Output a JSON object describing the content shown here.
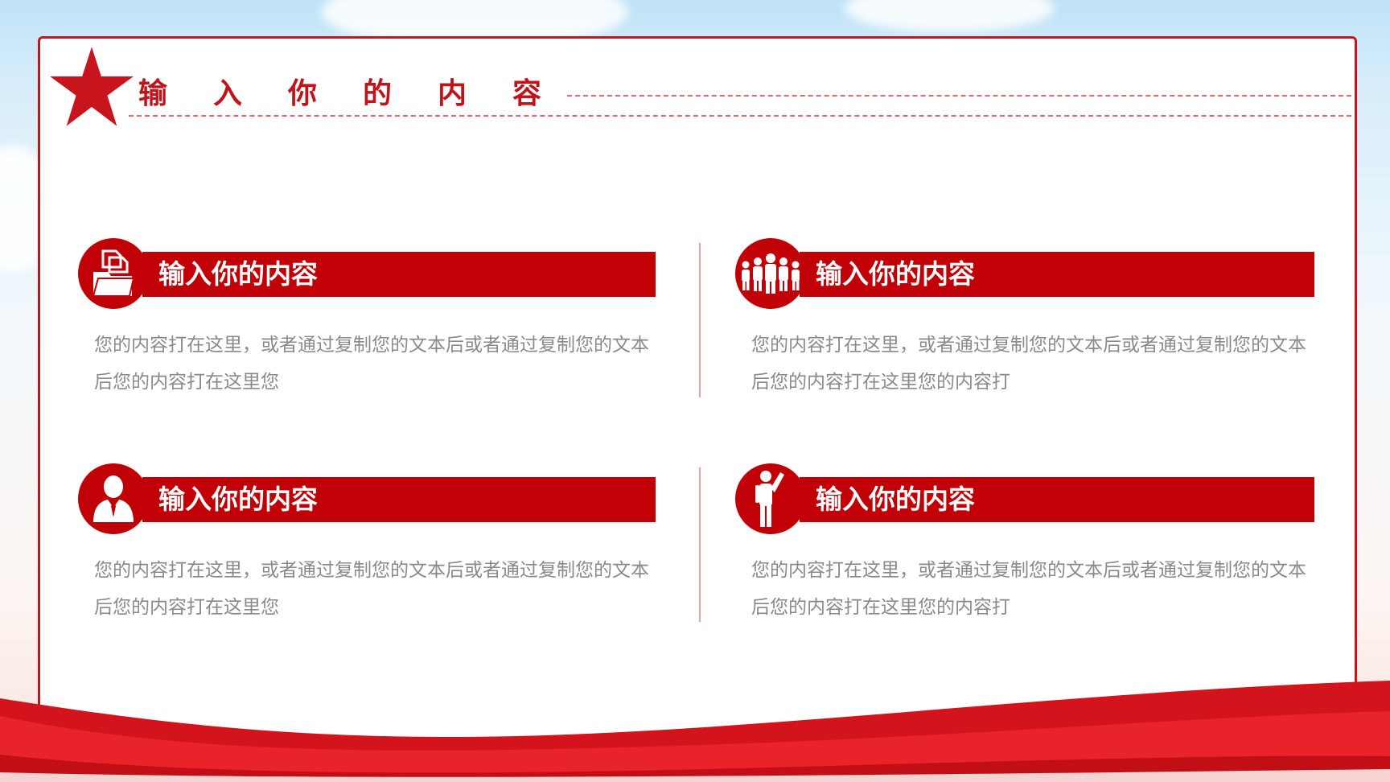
{
  "slide": {
    "title": "输入你的内容",
    "accent_color": "#c00006",
    "items": [
      {
        "heading": "输入你的内容",
        "icon": "folder-documents-icon",
        "body": "您的内容打在这里，或者通过复制您的文本后或者通过复制您的文本后您的内容打在这里您"
      },
      {
        "heading": "输入你的内容",
        "icon": "team-people-icon",
        "body": "您的内容打在这里，或者通过复制您的文本后或者通过复制您的文本后您的内容打在这里您的内容打"
      },
      {
        "heading": "输入你的内容",
        "icon": "business-person-icon",
        "body": "您的内容打在这里，或者通过复制您的文本后或者通过复制您的文本后您的内容打在这里您"
      },
      {
        "heading": "输入你的内容",
        "icon": "person-raising-hand-icon",
        "body": "您的内容打在这里，或者通过复制您的文本后或者通过复制您的文本后您的内容打在这里您的内容打"
      }
    ]
  }
}
